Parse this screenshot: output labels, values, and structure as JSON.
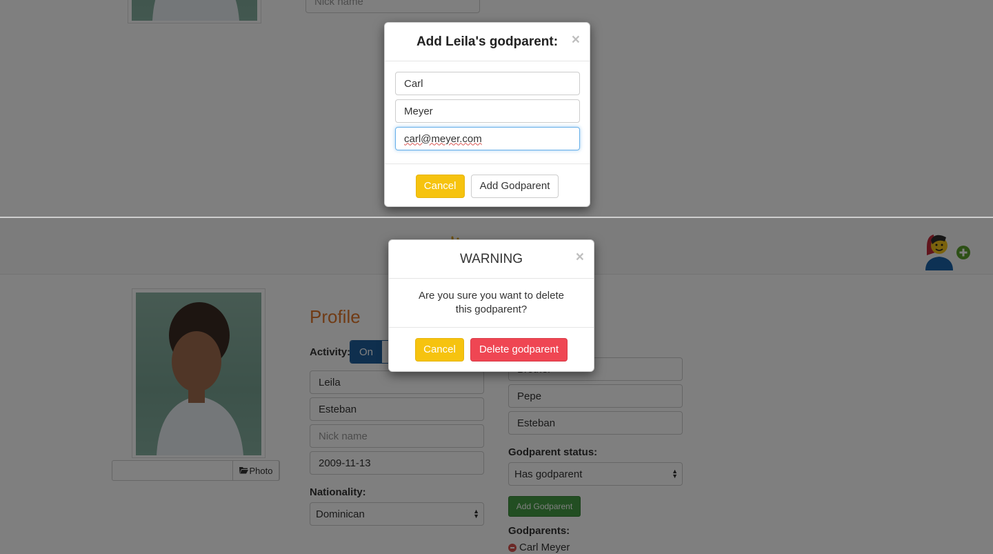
{
  "profile": {
    "title": "Profile",
    "activity_label": "Activity:",
    "activity_on": "On",
    "first_name": "Leila",
    "last_name": "Esteban",
    "nickname_placeholder": "Nick name",
    "birthdate": "2009-11-13",
    "nationality_label": "Nationality:",
    "nationality_value": "Dominican",
    "photo_button": "Photo",
    "right_fields": [
      "Brother",
      "Pepe",
      "Esteban"
    ],
    "godparent_status_label": "Godparent status:",
    "godparent_status_value": "Has godparent",
    "add_godparent_button": "Add Godparent",
    "godparents_label": "Godparents:",
    "godparents": [
      "Carl Meyer"
    ]
  },
  "add_modal": {
    "title": "Add Leila's godparent:",
    "close": "×",
    "first_name": "Carl",
    "last_name": "Meyer",
    "email": "carl@meyer.com",
    "cancel": "Cancel",
    "submit": "Add Godparent"
  },
  "warning_modal": {
    "title": "WARNING",
    "close": "×",
    "message": "Are you sure you want to delete this godparent?",
    "cancel": "Cancel",
    "confirm": "Delete godparent"
  },
  "colors": {
    "accent_orange": "#e0772a",
    "primary_blue": "#1f5e9c",
    "success_green": "#449d44",
    "warning_yellow": "#f6c30f",
    "danger_red": "#ef4653"
  },
  "icons": {
    "logo": "hands-logo-icon",
    "user_add": "user-add-icon",
    "folder": "folder-open-icon",
    "remove": "minus-circle-icon",
    "close": "close-icon"
  }
}
